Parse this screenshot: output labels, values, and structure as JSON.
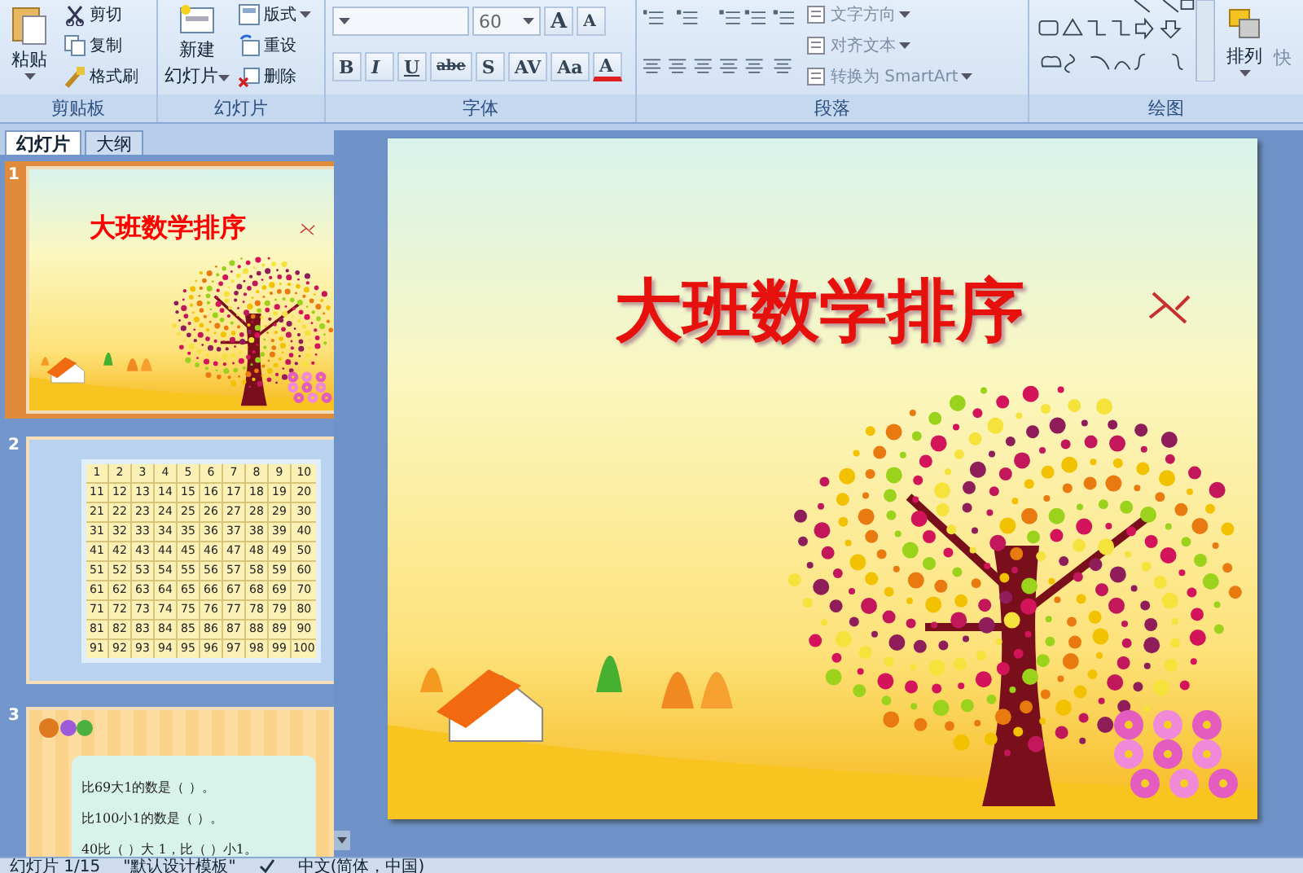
{
  "clipboard": {
    "label": "剪贴板",
    "paste": "粘贴",
    "items": [
      "剪切",
      "复制",
      "格式刷"
    ]
  },
  "slides_group": {
    "label": "幻灯片",
    "new_slide": [
      "新建",
      "幻灯片"
    ],
    "items": [
      "版式",
      "重设",
      "删除"
    ]
  },
  "font": {
    "label": "字体",
    "size": "60",
    "grow": "A",
    "shrink": "A",
    "buttons": [
      "B",
      "I",
      "U",
      "abe",
      "S",
      "AV",
      "Aa",
      "A"
    ]
  },
  "paragraph": {
    "label": "段落",
    "items": [
      "文字方向",
      "对齐文本",
      "转换为 SmartArt"
    ]
  },
  "drawing": {
    "label": "绘图",
    "arrange": "排列",
    "quick": "快"
  },
  "pane_tabs": [
    {
      "label": "幻灯片",
      "selected": true
    },
    {
      "label": "大纲",
      "selected": false
    }
  ],
  "thumbnails": [
    {
      "number": "1",
      "selected": true,
      "kind": "title",
      "title": "大班数学排序"
    },
    {
      "number": "2",
      "selected": false,
      "kind": "grid",
      "rows": [
        [
          "1",
          "2",
          "3",
          "4",
          "5",
          "6",
          "7",
          "8",
          "9",
          "10"
        ],
        [
          "11",
          "12",
          "13",
          "14",
          "15",
          "16",
          "17",
          "18",
          "19",
          "20"
        ],
        [
          "21",
          "22",
          "23",
          "24",
          "25",
          "26",
          "27",
          "28",
          "29",
          "30"
        ],
        [
          "31",
          "32",
          "33",
          "34",
          "35",
          "36",
          "37",
          "38",
          "39",
          "40"
        ],
        [
          "41",
          "42",
          "43",
          "44",
          "45",
          "46",
          "47",
          "48",
          "49",
          "50"
        ],
        [
          "51",
          "52",
          "53",
          "54",
          "55",
          "56",
          "57",
          "58",
          "59",
          "60"
        ],
        [
          "61",
          "62",
          "63",
          "64",
          "65",
          "66",
          "67",
          "68",
          "69",
          "70"
        ],
        [
          "71",
          "72",
          "73",
          "74",
          "75",
          "76",
          "77",
          "78",
          "79",
          "80"
        ],
        [
          "81",
          "82",
          "83",
          "84",
          "85",
          "86",
          "87",
          "88",
          "89",
          "90"
        ],
        [
          "91",
          "92",
          "93",
          "94",
          "95",
          "96",
          "97",
          "98",
          "99",
          "100"
        ]
      ]
    },
    {
      "number": "3",
      "selected": false,
      "kind": "quiz",
      "lines": [
        "比69大1的数是（ ）。",
        "比100小1的数是（ ）。",
        "40比（ ）大 1，比（ ）小1。"
      ]
    }
  ],
  "slide": {
    "title": "大班数学排序"
  },
  "status_bar": {
    "slide": "幻灯片 1/15",
    "theme": "\"默认设计模板\"",
    "language": "中文(简体，中国)"
  }
}
